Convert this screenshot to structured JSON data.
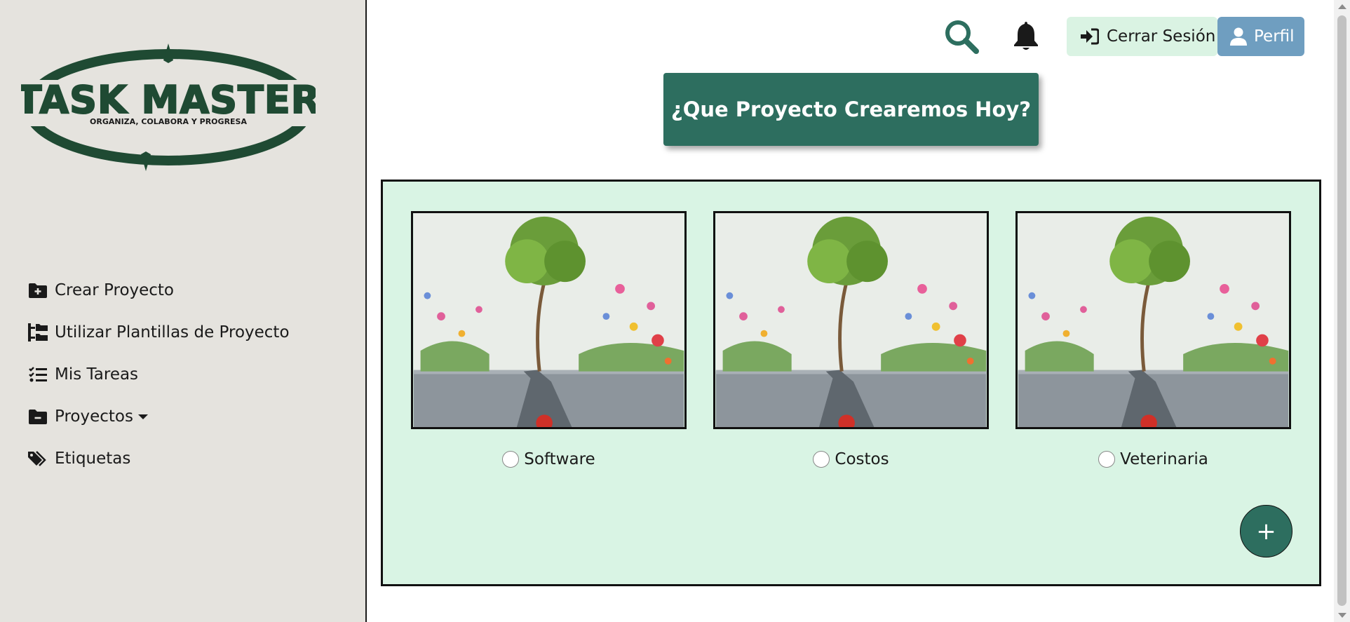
{
  "logo": {
    "title": "TASK MASTER",
    "tagline": "ORGANIZA, COLABORA Y PROGRESA"
  },
  "sidebar": {
    "items": [
      {
        "label": "Crear Proyecto",
        "icon": "folder-plus-icon"
      },
      {
        "label": "Utilizar Plantillas de Proyecto",
        "icon": "folder-tree-icon"
      },
      {
        "label": "Mis Tareas",
        "icon": "list-check-icon"
      },
      {
        "label": "Proyectos",
        "icon": "folder-minus-icon"
      },
      {
        "label": "Etiquetas",
        "icon": "tags-icon"
      }
    ]
  },
  "header": {
    "logout_label": "Cerrar Sesión",
    "profile_label": "Perfil"
  },
  "hero": {
    "title": "¿Que Proyecto Crearemos Hoy?"
  },
  "templates": [
    {
      "label": "Software"
    },
    {
      "label": "Costos"
    },
    {
      "label": "Veterinaria"
    }
  ],
  "actions": {
    "add_label": "+"
  },
  "colors": {
    "accent": "#2d6e5f",
    "panel": "#d9f4e4",
    "profile": "#6f9ec0",
    "logout": "#daf3e3",
    "sidebar": "#e5e3de"
  }
}
